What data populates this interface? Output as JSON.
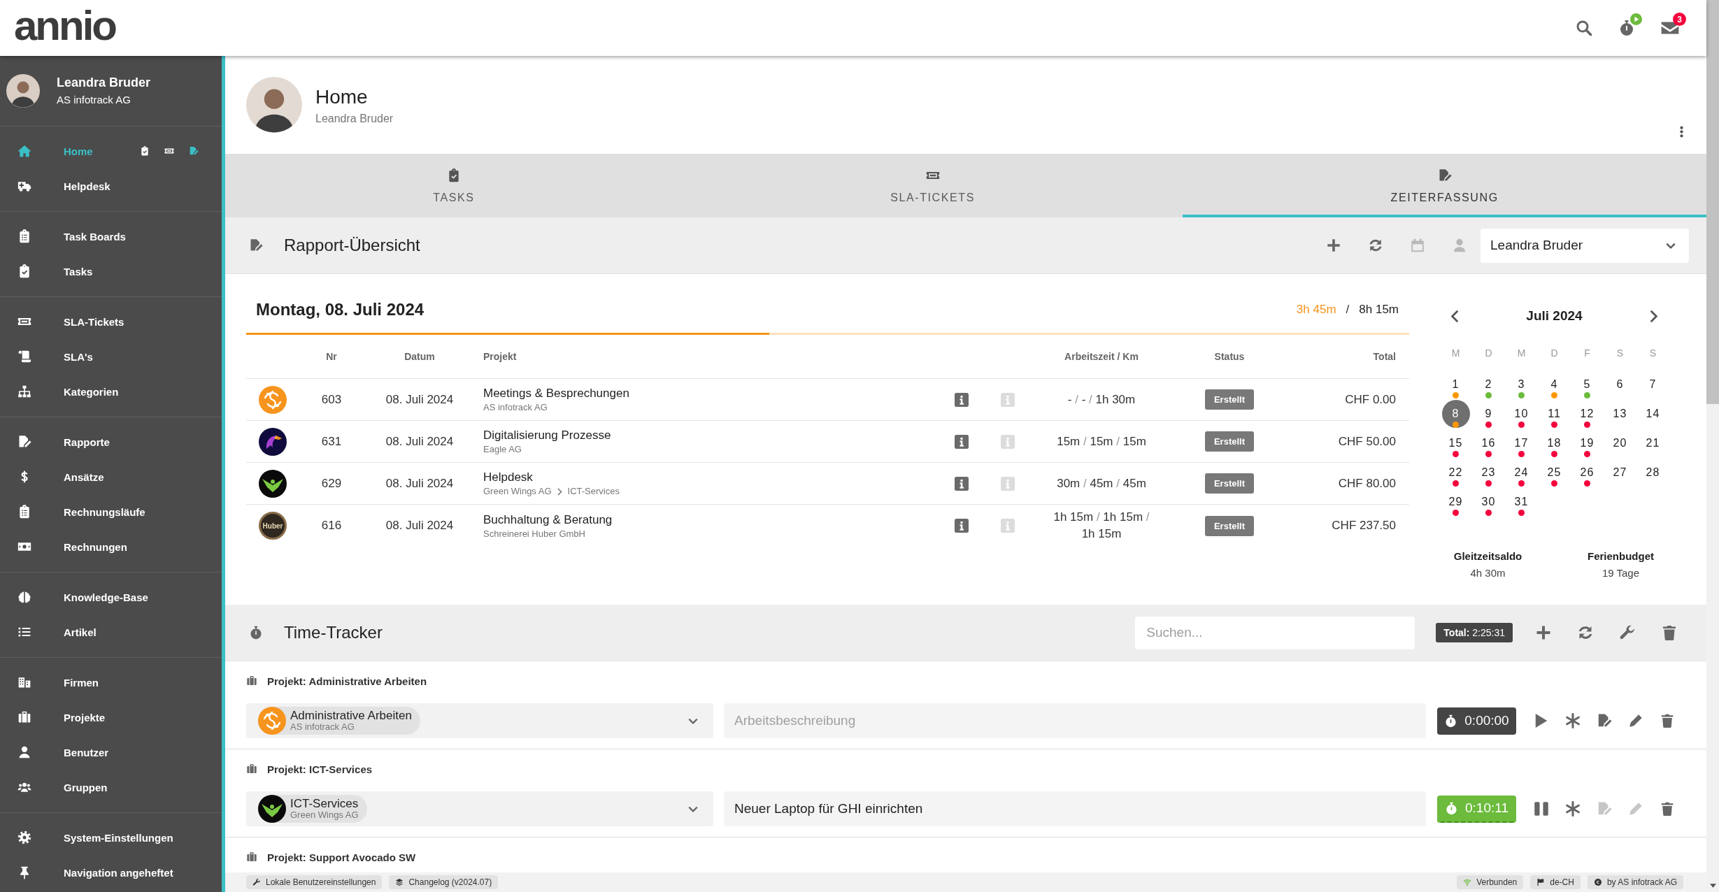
{
  "header": {
    "logo": "annio",
    "timer_running": true,
    "mail_count": "3"
  },
  "sidebar": {
    "user": {
      "name": "Leandra Bruder",
      "company": "AS infotrack AG"
    },
    "groups": [
      {
        "items": [
          {
            "label": "Home",
            "selected": true,
            "shortcuts": [
              {
                "selected": false
              },
              {
                "selected": false
              },
              {
                "selected": true
              }
            ]
          },
          {
            "label": "Helpdesk",
            "selected": false
          }
        ]
      },
      {
        "items": [
          {
            "label": "Task Boards",
            "selected": false
          },
          {
            "label": "Tasks",
            "selected": false
          }
        ]
      },
      {
        "items": [
          {
            "label": "SLA-Tickets",
            "selected": false
          },
          {
            "label": "SLA's",
            "selected": false
          },
          {
            "label": "Kategorien",
            "selected": false
          }
        ]
      },
      {
        "items": [
          {
            "label": "Rapporte",
            "selected": false
          },
          {
            "label": "Ansätze",
            "selected": false
          },
          {
            "label": "Rechnungsläufe",
            "selected": false
          },
          {
            "label": "Rechnungen",
            "selected": false
          }
        ]
      },
      {
        "items": [
          {
            "label": "Knowledge-Base",
            "selected": false
          },
          {
            "label": "Artikel",
            "selected": false
          }
        ]
      },
      {
        "items": [
          {
            "label": "Firmen",
            "selected": false
          },
          {
            "label": "Projekte",
            "selected": false
          },
          {
            "label": "Benutzer",
            "selected": false
          },
          {
            "label": "Gruppen",
            "selected": false
          }
        ]
      },
      {
        "items": [
          {
            "label": "System-Einstellungen",
            "selected": false
          },
          {
            "label": "Navigation angeheftet",
            "selected": false
          }
        ]
      }
    ]
  },
  "page_header": {
    "title": "Home",
    "subtitle": "Leandra Bruder"
  },
  "tabs": [
    {
      "label": "TASKS",
      "selected": false
    },
    {
      "label": "SLA-TICKETS",
      "selected": false
    },
    {
      "label": "ZEITERFASSUNG",
      "selected": true
    }
  ],
  "rapport": {
    "title": "Rapport-Übersicht",
    "user_select": "Leandra Bruder",
    "date": "Montag, 08. Juli 2024",
    "worked": "3h 45m",
    "separator": "/",
    "target": "8h 15m",
    "level": 0.45,
    "columns": [
      "Nr",
      "Datum",
      "Projekt",
      "Arbeitszeit / Km",
      "Status",
      "Total"
    ],
    "rows": [
      {
        "kind": "swirl",
        "nr": "603",
        "date": "08. Juli 2024",
        "project": "Meetings & Besprechungen",
        "client": [
          "AS infotrack AG"
        ],
        "work": [
          "-",
          "/",
          "-",
          "/",
          "1h 30m"
        ],
        "status": "Erstellt",
        "total": "CHF 0.00"
      },
      {
        "kind": "eagle",
        "nr": "631",
        "date": "08. Juli 2024",
        "project": "Digitalisierung Prozesse",
        "client": [
          "Eagle AG"
        ],
        "work": [
          "15m",
          "/",
          "15m",
          "/",
          "15m"
        ],
        "status": "Erstellt",
        "total": "CHF 50.00"
      },
      {
        "kind": "wings",
        "nr": "629",
        "date": "08. Juli 2024",
        "project": "Helpdesk",
        "client": [
          "Green Wings AG",
          "ICT-Services"
        ],
        "work": [
          "30m",
          "/",
          "45m",
          "/",
          "45m"
        ],
        "status": "Erstellt",
        "total": "CHF 80.00"
      },
      {
        "kind": "letter",
        "logo_text": "Huber",
        "nr": "616",
        "date": "08. Juli 2024",
        "project": "Buchhaltung & Beratung",
        "client": [
          "Schreinerei Huber GmbH"
        ],
        "work": [
          "1h 15m",
          "/",
          "1h 15m",
          "/",
          "1h 15m"
        ],
        "status": "Erstellt",
        "total": "CHF 237.50"
      }
    ]
  },
  "calendar": {
    "month": "Juli 2024",
    "weekdays": [
      "M",
      "D",
      "M",
      "D",
      "F",
      "S",
      "S"
    ],
    "days": [
      {
        "day": "1",
        "selected": false,
        "color": "#ff9800"
      },
      {
        "day": "2",
        "selected": false,
        "color": "#6cbb3c"
      },
      {
        "day": "3",
        "selected": false,
        "color": "#6cbb3c"
      },
      {
        "day": "4",
        "selected": false,
        "color": "#ff9800"
      },
      {
        "day": "5",
        "selected": false,
        "color": "#6cbb3c"
      },
      {
        "day": "6",
        "selected": false
      },
      {
        "day": "7",
        "selected": false
      },
      {
        "day": "8",
        "selected": true,
        "color": "#ff9800"
      },
      {
        "day": "9",
        "selected": false,
        "color": "#f5033d"
      },
      {
        "day": "10",
        "selected": false,
        "color": "#f5033d"
      },
      {
        "day": "11",
        "selected": false,
        "color": "#f5033d"
      },
      {
        "day": "12",
        "selected": false,
        "color": "#f5033d"
      },
      {
        "day": "13",
        "selected": false
      },
      {
        "day": "14",
        "selected": false
      },
      {
        "day": "15",
        "selected": false,
        "color": "#f5033d"
      },
      {
        "day": "16",
        "selected": false,
        "color": "#f5033d"
      },
      {
        "day": "17",
        "selected": false,
        "color": "#f5033d"
      },
      {
        "day": "18",
        "selected": false,
        "color": "#f5033d"
      },
      {
        "day": "19",
        "selected": false,
        "color": "#f5033d"
      },
      {
        "day": "20",
        "selected": false
      },
      {
        "day": "21",
        "selected": false
      },
      {
        "day": "22",
        "selected": false,
        "color": "#f5033d"
      },
      {
        "day": "23",
        "selected": false,
        "color": "#f5033d"
      },
      {
        "day": "24",
        "selected": false,
        "color": "#f5033d"
      },
      {
        "day": "25",
        "selected": false,
        "color": "#f5033d"
      },
      {
        "day": "26",
        "selected": false,
        "color": "#f5033d"
      },
      {
        "day": "27",
        "selected": false
      },
      {
        "day": "28",
        "selected": false
      },
      {
        "day": "29",
        "selected": false,
        "color": "#f5033d"
      },
      {
        "day": "30",
        "selected": false,
        "color": "#f5033d"
      },
      {
        "day": "31",
        "selected": false,
        "color": "#f5033d"
      }
    ],
    "summary": [
      {
        "label": "Gleitzeitsaldo",
        "value": "4h 30m"
      },
      {
        "label": "Ferienbudget",
        "value": "19 Tage"
      }
    ]
  },
  "tracker": {
    "title": "Time-Tracker",
    "search": {
      "placeholder": "Suchen..."
    },
    "total": "**Total:** 2:25:31",
    "groups": [
      {
        "heading": "Projekt: Administrative Arbeiten",
        "kind": "swirl",
        "project": "Administrative Arbeiten",
        "client": "AS infotrack AG",
        "description": {
          "placeholder": "Arbeitsbeschreibung"
        },
        "timer": "0:00:00",
        "running": false
      },
      {
        "heading": "Projekt: ICT-Services",
        "kind": "wings",
        "project": "ICT-Services",
        "client": "Green Wings AG",
        "description": {
          "value": "Neuer Laptop für GHI einrichten"
        },
        "timer": "0:10:11",
        "running": true
      },
      {
        "heading": "Projekt: Support Avocado SW"
      }
    ]
  },
  "footer": {
    "left": [
      "Lokale Benutzereinstellungen",
      "Changelog (v2024.07)"
    ],
    "right": [
      "Verbunden",
      "de-CH",
      "by AS infotrack AG"
    ]
  }
}
